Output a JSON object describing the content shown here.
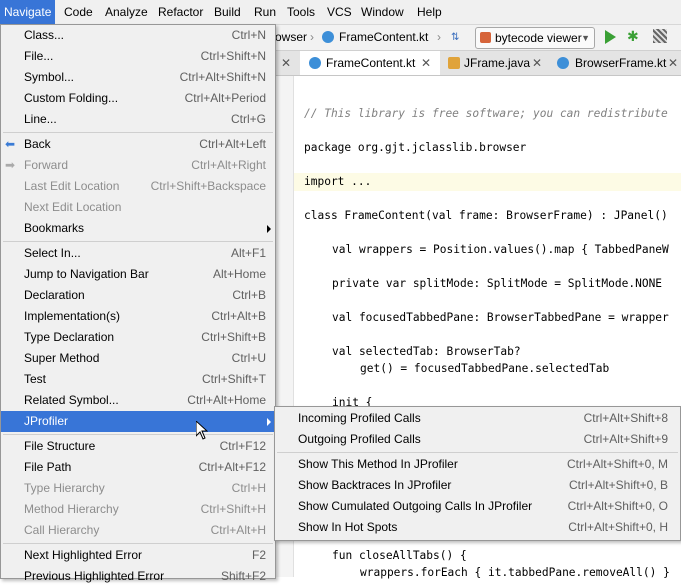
{
  "menubar": {
    "items": [
      "Navigate",
      "Code",
      "Analyze",
      "Refactor",
      "Build",
      "Run",
      "Tools",
      "VCS",
      "Window",
      "Help"
    ]
  },
  "navbar": {
    "crumb_prev": "owser",
    "crumb_file": "FrameContent.kt",
    "run_config": "bytecode viewer"
  },
  "tabs": [
    "FrameContent.kt",
    "JFrame.java",
    "BrowserFrame.kt"
  ],
  "editor": {
    "lines": [
      "// This library is free software; you can redistribute",
      "package org.gjt.jclasslib.browser",
      "import ...",
      "class FrameContent(val frame: BrowserFrame) : JPanel()",
      "val wrappers = Position.values().map { TabbedPaneW",
      "private var splitMode: SplitMode = SplitMode.NONE",
      "val focusedTabbedPane: BrowserTabbedPane = wrapper",
      "val selectedTab: BrowserTab?",
      "get() = focusedTabbedPane.selectedTab",
      "init {",
      "fun closeAllTabs() {",
      "wrappers.forEach { it.tabbedPane.removeAll() }"
    ]
  },
  "navigate_menu": {
    "items": [
      {
        "label": "Class...",
        "shortcut": "Ctrl+N"
      },
      {
        "label": "File...",
        "shortcut": "Ctrl+Shift+N"
      },
      {
        "label": "Symbol...",
        "shortcut": "Ctrl+Alt+Shift+N"
      },
      {
        "label": "Custom Folding...",
        "shortcut": "Ctrl+Alt+Period"
      },
      {
        "label": "Line...",
        "shortcut": "Ctrl+G"
      },
      {
        "label": "Back",
        "shortcut": "Ctrl+Alt+Left"
      },
      {
        "label": "Forward",
        "shortcut": "Ctrl+Alt+Right"
      },
      {
        "label": "Last Edit Location",
        "shortcut": "Ctrl+Shift+Backspace"
      },
      {
        "label": "Next Edit Location",
        "shortcut": ""
      },
      {
        "label": "Bookmarks",
        "shortcut": ""
      },
      {
        "label": "Select In...",
        "shortcut": "Alt+F1"
      },
      {
        "label": "Jump to Navigation Bar",
        "shortcut": "Alt+Home"
      },
      {
        "label": "Declaration",
        "shortcut": "Ctrl+B"
      },
      {
        "label": "Implementation(s)",
        "shortcut": "Ctrl+Alt+B"
      },
      {
        "label": "Type Declaration",
        "shortcut": "Ctrl+Shift+B"
      },
      {
        "label": "Super Method",
        "shortcut": "Ctrl+U"
      },
      {
        "label": "Test",
        "shortcut": "Ctrl+Shift+T"
      },
      {
        "label": "Related Symbol...",
        "shortcut": "Ctrl+Alt+Home"
      },
      {
        "label": "JProfiler",
        "shortcut": ""
      },
      {
        "label": "File Structure",
        "shortcut": "Ctrl+F12"
      },
      {
        "label": "File Path",
        "shortcut": "Ctrl+Alt+F12"
      },
      {
        "label": "Type Hierarchy",
        "shortcut": "Ctrl+H"
      },
      {
        "label": "Method Hierarchy",
        "shortcut": "Ctrl+Shift+H"
      },
      {
        "label": "Call Hierarchy",
        "shortcut": "Ctrl+Alt+H"
      },
      {
        "label": "Next Highlighted Error",
        "shortcut": "F2"
      },
      {
        "label": "Previous Highlighted Error",
        "shortcut": "Shift+F2"
      }
    ]
  },
  "jprofiler_menu": {
    "items": [
      {
        "label": "Incoming Profiled Calls",
        "shortcut": "Ctrl+Alt+Shift+8"
      },
      {
        "label": "Outgoing Profiled Calls",
        "shortcut": "Ctrl+Alt+Shift+9"
      },
      {
        "label": "Show This Method In JProfiler",
        "shortcut": "Ctrl+Alt+Shift+0, M"
      },
      {
        "label": "Show Backtraces In JProfiler",
        "shortcut": "Ctrl+Alt+Shift+0, B"
      },
      {
        "label": "Show Cumulated Outgoing Calls In JProfiler",
        "shortcut": "Ctrl+Alt+Shift+0, O"
      },
      {
        "label": "Show In Hot Spots",
        "shortcut": "Ctrl+Alt+Shift+0, H"
      }
    ]
  },
  "colors": {
    "selection": "#3875d7",
    "menu_bg": "#f0f0f0"
  }
}
